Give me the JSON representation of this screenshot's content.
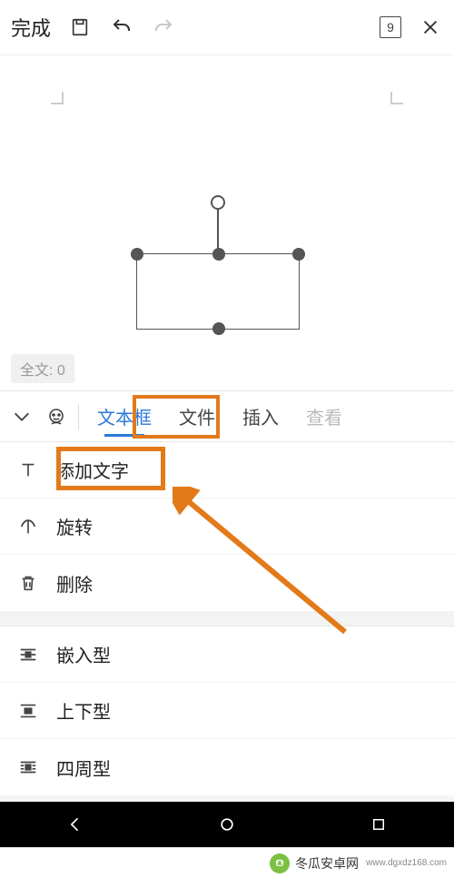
{
  "topbar": {
    "done_label": "完成",
    "page_count": "9"
  },
  "canvas": {
    "wordcount_label": "全文: 0"
  },
  "tabs": {
    "items": [
      {
        "label": "文本框",
        "active": true
      },
      {
        "label": "文件",
        "active": false
      },
      {
        "label": "插入",
        "active": false
      },
      {
        "label": "查看",
        "active": false,
        "dim": true
      }
    ]
  },
  "options_group1": [
    {
      "icon": "text",
      "label": "添加文字"
    },
    {
      "icon": "rotate",
      "label": "旋转"
    },
    {
      "icon": "delete",
      "label": "删除"
    }
  ],
  "options_group2": [
    {
      "icon": "wrap-inline",
      "label": "嵌入型"
    },
    {
      "icon": "wrap-topbottom",
      "label": "上下型"
    },
    {
      "icon": "wrap-square",
      "label": "四周型"
    }
  ],
  "watermark": {
    "text": "冬瓜安卓网",
    "url": "www.dgxdz168.com"
  }
}
